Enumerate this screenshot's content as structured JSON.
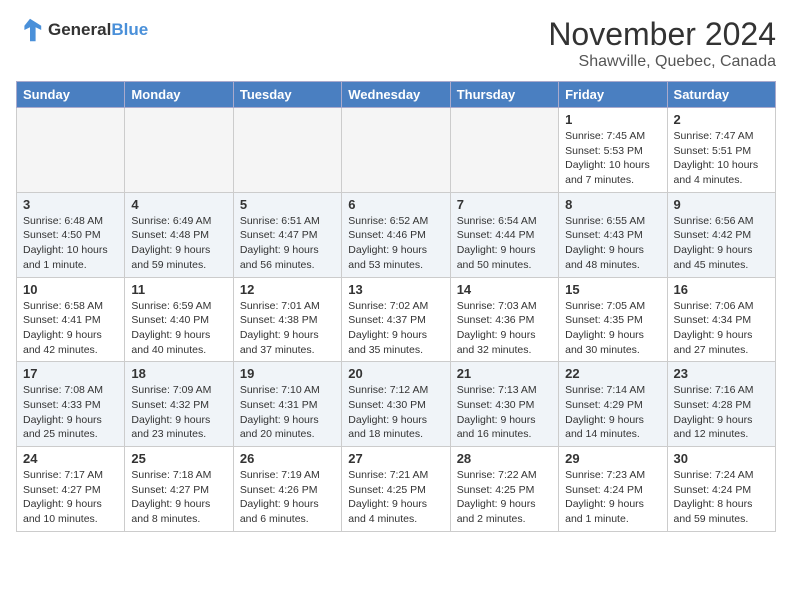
{
  "logo": {
    "text_general": "General",
    "text_blue": "Blue"
  },
  "title": "November 2024",
  "location": "Shawville, Quebec, Canada",
  "days_of_week": [
    "Sunday",
    "Monday",
    "Tuesday",
    "Wednesday",
    "Thursday",
    "Friday",
    "Saturday"
  ],
  "weeks": [
    [
      {
        "day": "",
        "info": ""
      },
      {
        "day": "",
        "info": ""
      },
      {
        "day": "",
        "info": ""
      },
      {
        "day": "",
        "info": ""
      },
      {
        "day": "",
        "info": ""
      },
      {
        "day": "1",
        "info": "Sunrise: 7:45 AM\nSunset: 5:53 PM\nDaylight: 10 hours and 7 minutes."
      },
      {
        "day": "2",
        "info": "Sunrise: 7:47 AM\nSunset: 5:51 PM\nDaylight: 10 hours and 4 minutes."
      }
    ],
    [
      {
        "day": "3",
        "info": "Sunrise: 6:48 AM\nSunset: 4:50 PM\nDaylight: 10 hours and 1 minute."
      },
      {
        "day": "4",
        "info": "Sunrise: 6:49 AM\nSunset: 4:48 PM\nDaylight: 9 hours and 59 minutes."
      },
      {
        "day": "5",
        "info": "Sunrise: 6:51 AM\nSunset: 4:47 PM\nDaylight: 9 hours and 56 minutes."
      },
      {
        "day": "6",
        "info": "Sunrise: 6:52 AM\nSunset: 4:46 PM\nDaylight: 9 hours and 53 minutes."
      },
      {
        "day": "7",
        "info": "Sunrise: 6:54 AM\nSunset: 4:44 PM\nDaylight: 9 hours and 50 minutes."
      },
      {
        "day": "8",
        "info": "Sunrise: 6:55 AM\nSunset: 4:43 PM\nDaylight: 9 hours and 48 minutes."
      },
      {
        "day": "9",
        "info": "Sunrise: 6:56 AM\nSunset: 4:42 PM\nDaylight: 9 hours and 45 minutes."
      }
    ],
    [
      {
        "day": "10",
        "info": "Sunrise: 6:58 AM\nSunset: 4:41 PM\nDaylight: 9 hours and 42 minutes."
      },
      {
        "day": "11",
        "info": "Sunrise: 6:59 AM\nSunset: 4:40 PM\nDaylight: 9 hours and 40 minutes."
      },
      {
        "day": "12",
        "info": "Sunrise: 7:01 AM\nSunset: 4:38 PM\nDaylight: 9 hours and 37 minutes."
      },
      {
        "day": "13",
        "info": "Sunrise: 7:02 AM\nSunset: 4:37 PM\nDaylight: 9 hours and 35 minutes."
      },
      {
        "day": "14",
        "info": "Sunrise: 7:03 AM\nSunset: 4:36 PM\nDaylight: 9 hours and 32 minutes."
      },
      {
        "day": "15",
        "info": "Sunrise: 7:05 AM\nSunset: 4:35 PM\nDaylight: 9 hours and 30 minutes."
      },
      {
        "day": "16",
        "info": "Sunrise: 7:06 AM\nSunset: 4:34 PM\nDaylight: 9 hours and 27 minutes."
      }
    ],
    [
      {
        "day": "17",
        "info": "Sunrise: 7:08 AM\nSunset: 4:33 PM\nDaylight: 9 hours and 25 minutes."
      },
      {
        "day": "18",
        "info": "Sunrise: 7:09 AM\nSunset: 4:32 PM\nDaylight: 9 hours and 23 minutes."
      },
      {
        "day": "19",
        "info": "Sunrise: 7:10 AM\nSunset: 4:31 PM\nDaylight: 9 hours and 20 minutes."
      },
      {
        "day": "20",
        "info": "Sunrise: 7:12 AM\nSunset: 4:30 PM\nDaylight: 9 hours and 18 minutes."
      },
      {
        "day": "21",
        "info": "Sunrise: 7:13 AM\nSunset: 4:30 PM\nDaylight: 9 hours and 16 minutes."
      },
      {
        "day": "22",
        "info": "Sunrise: 7:14 AM\nSunset: 4:29 PM\nDaylight: 9 hours and 14 minutes."
      },
      {
        "day": "23",
        "info": "Sunrise: 7:16 AM\nSunset: 4:28 PM\nDaylight: 9 hours and 12 minutes."
      }
    ],
    [
      {
        "day": "24",
        "info": "Sunrise: 7:17 AM\nSunset: 4:27 PM\nDaylight: 9 hours and 10 minutes."
      },
      {
        "day": "25",
        "info": "Sunrise: 7:18 AM\nSunset: 4:27 PM\nDaylight: 9 hours and 8 minutes."
      },
      {
        "day": "26",
        "info": "Sunrise: 7:19 AM\nSunset: 4:26 PM\nDaylight: 9 hours and 6 minutes."
      },
      {
        "day": "27",
        "info": "Sunrise: 7:21 AM\nSunset: 4:25 PM\nDaylight: 9 hours and 4 minutes."
      },
      {
        "day": "28",
        "info": "Sunrise: 7:22 AM\nSunset: 4:25 PM\nDaylight: 9 hours and 2 minutes."
      },
      {
        "day": "29",
        "info": "Sunrise: 7:23 AM\nSunset: 4:24 PM\nDaylight: 9 hours and 1 minute."
      },
      {
        "day": "30",
        "info": "Sunrise: 7:24 AM\nSunset: 4:24 PM\nDaylight: 8 hours and 59 minutes."
      }
    ]
  ]
}
